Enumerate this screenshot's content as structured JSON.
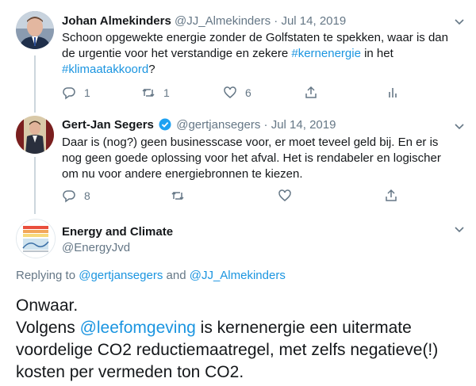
{
  "tweet1": {
    "name": "Johan Almekinders",
    "handle": "@JJ_Almekinders",
    "dot": "·",
    "date": "Jul 14, 2019",
    "text_a": "Schoon opgewekte energie zonder de Golfstaten te spekken, waar is dan de urgentie voor het verstandige en zekere ",
    "hashtag1": "#kernenergie",
    "text_b": " in het ",
    "hashtag2": "#klimaatakkoord",
    "text_c": "?",
    "reply_count": "1",
    "retweet_count": "1",
    "like_count": "6"
  },
  "tweet2": {
    "name": "Gert-Jan Segers",
    "handle": "@gertjansegers",
    "dot": "·",
    "date": "Jul 14, 2019",
    "text": "Daar is (nog?) geen businesscase voor, er moet teveel geld bij. En er is nog geen goede oplossing voor het afval. Het is rendabeler en logischer om nu voor andere energiebronnen te kiezen.",
    "reply_count": "8"
  },
  "tweet3": {
    "name": "Energy and Climate",
    "handle": "@EnergyJvd",
    "replying_prefix": "Replying to ",
    "replying_user1": "@gertjansegers",
    "replying_and": " and ",
    "replying_user2": "@JJ_Almekinders",
    "text_a": "Onwaar.",
    "text_b": "Volgens ",
    "mention": "@leefomgeving",
    "text_c": " is kernenergie een uitermate voordelige CO2 reductiemaatregel, met zelfs negatieve(!) kosten per vermeden ton CO2."
  },
  "colors": {
    "link": "#1b95e0",
    "muted": "#657786",
    "verified": "#1da1f2"
  },
  "icons": {
    "reply": "reply-icon",
    "retweet": "retweet-icon",
    "like": "heart-icon",
    "share": "share-icon",
    "analytics": "analytics-icon",
    "caret": "chevron-down-icon",
    "verified": "verified-badge-icon"
  }
}
